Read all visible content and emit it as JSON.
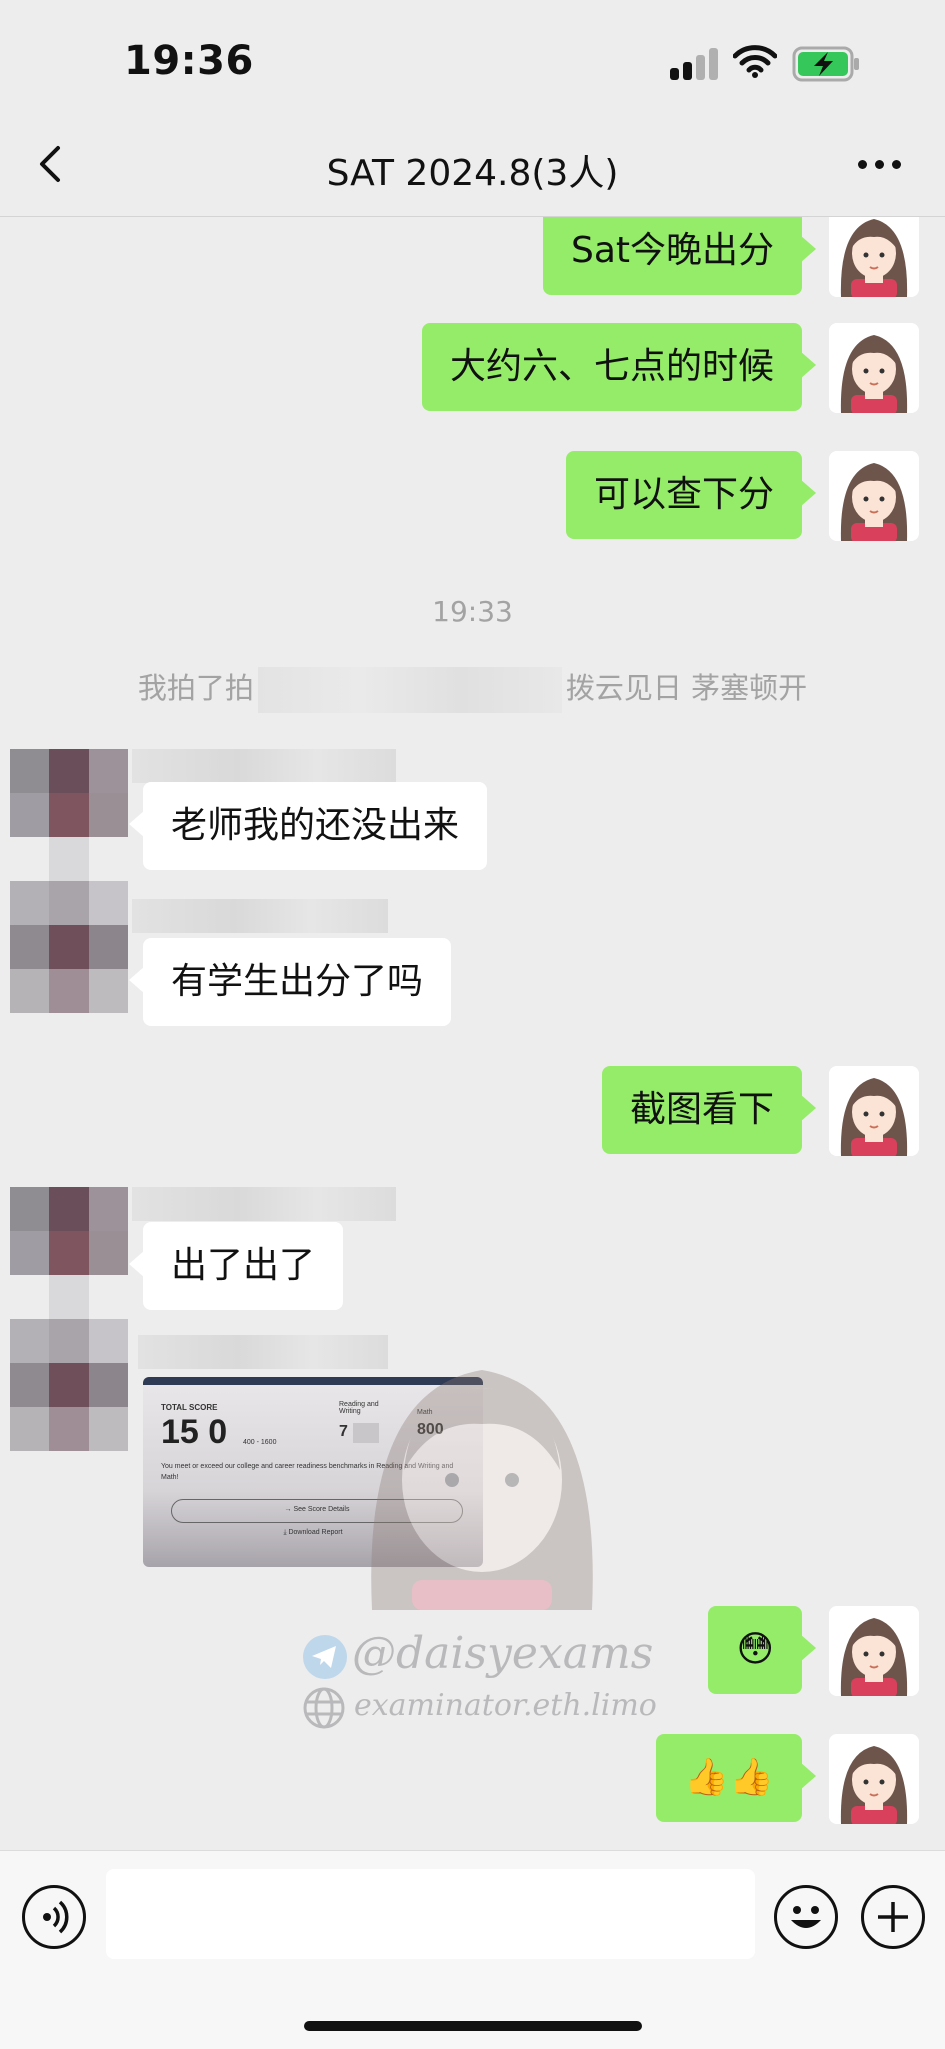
{
  "status_bar": {
    "time": "19:36"
  },
  "nav": {
    "title": "SAT 2024.8(3人)"
  },
  "messages": [
    {
      "side": "out",
      "text": "Sat今晚出分"
    },
    {
      "side": "out",
      "text": "大约六、七点的时候"
    },
    {
      "side": "out",
      "text": "可以查下分"
    },
    {
      "type": "time",
      "text": "19:33"
    },
    {
      "type": "system",
      "before": "我拍了拍",
      "after": "拨云见日 茅塞顿开"
    },
    {
      "side": "in",
      "text": "老师我的还没出来"
    },
    {
      "side": "in",
      "text": "有学生出分了吗"
    },
    {
      "side": "out",
      "text": "截图看下"
    },
    {
      "side": "in",
      "text": "出了出了"
    },
    {
      "side": "in",
      "type": "image"
    },
    {
      "side": "out",
      "text": "😳"
    },
    {
      "side": "out",
      "text": "👍👍"
    }
  ],
  "score_report": {
    "total_label": "TOTAL SCORE",
    "total_value": "15 0",
    "total_range": "400 - 1600",
    "rw_label": "Reading and Writing",
    "rw_value": "7",
    "math_label": "Math",
    "math_value": "800",
    "note": "You meet or exceed our college and career readiness benchmarks in Reading and Writing and Math!",
    "details_label": "→  See Score Details",
    "download_label": "⤓  Download Report"
  },
  "watermark": {
    "handle": "@daisyexams",
    "site": "examinator.eth.limo"
  },
  "colors": {
    "sent_bubble": "#95ec69",
    "received_bubble": "#ffffff",
    "background": "#ededed"
  },
  "icons": [
    "back-arrow-icon",
    "more-icon",
    "voice-icon",
    "emoji-icon",
    "plus-icon",
    "telegram-icon",
    "globe-icon"
  ]
}
